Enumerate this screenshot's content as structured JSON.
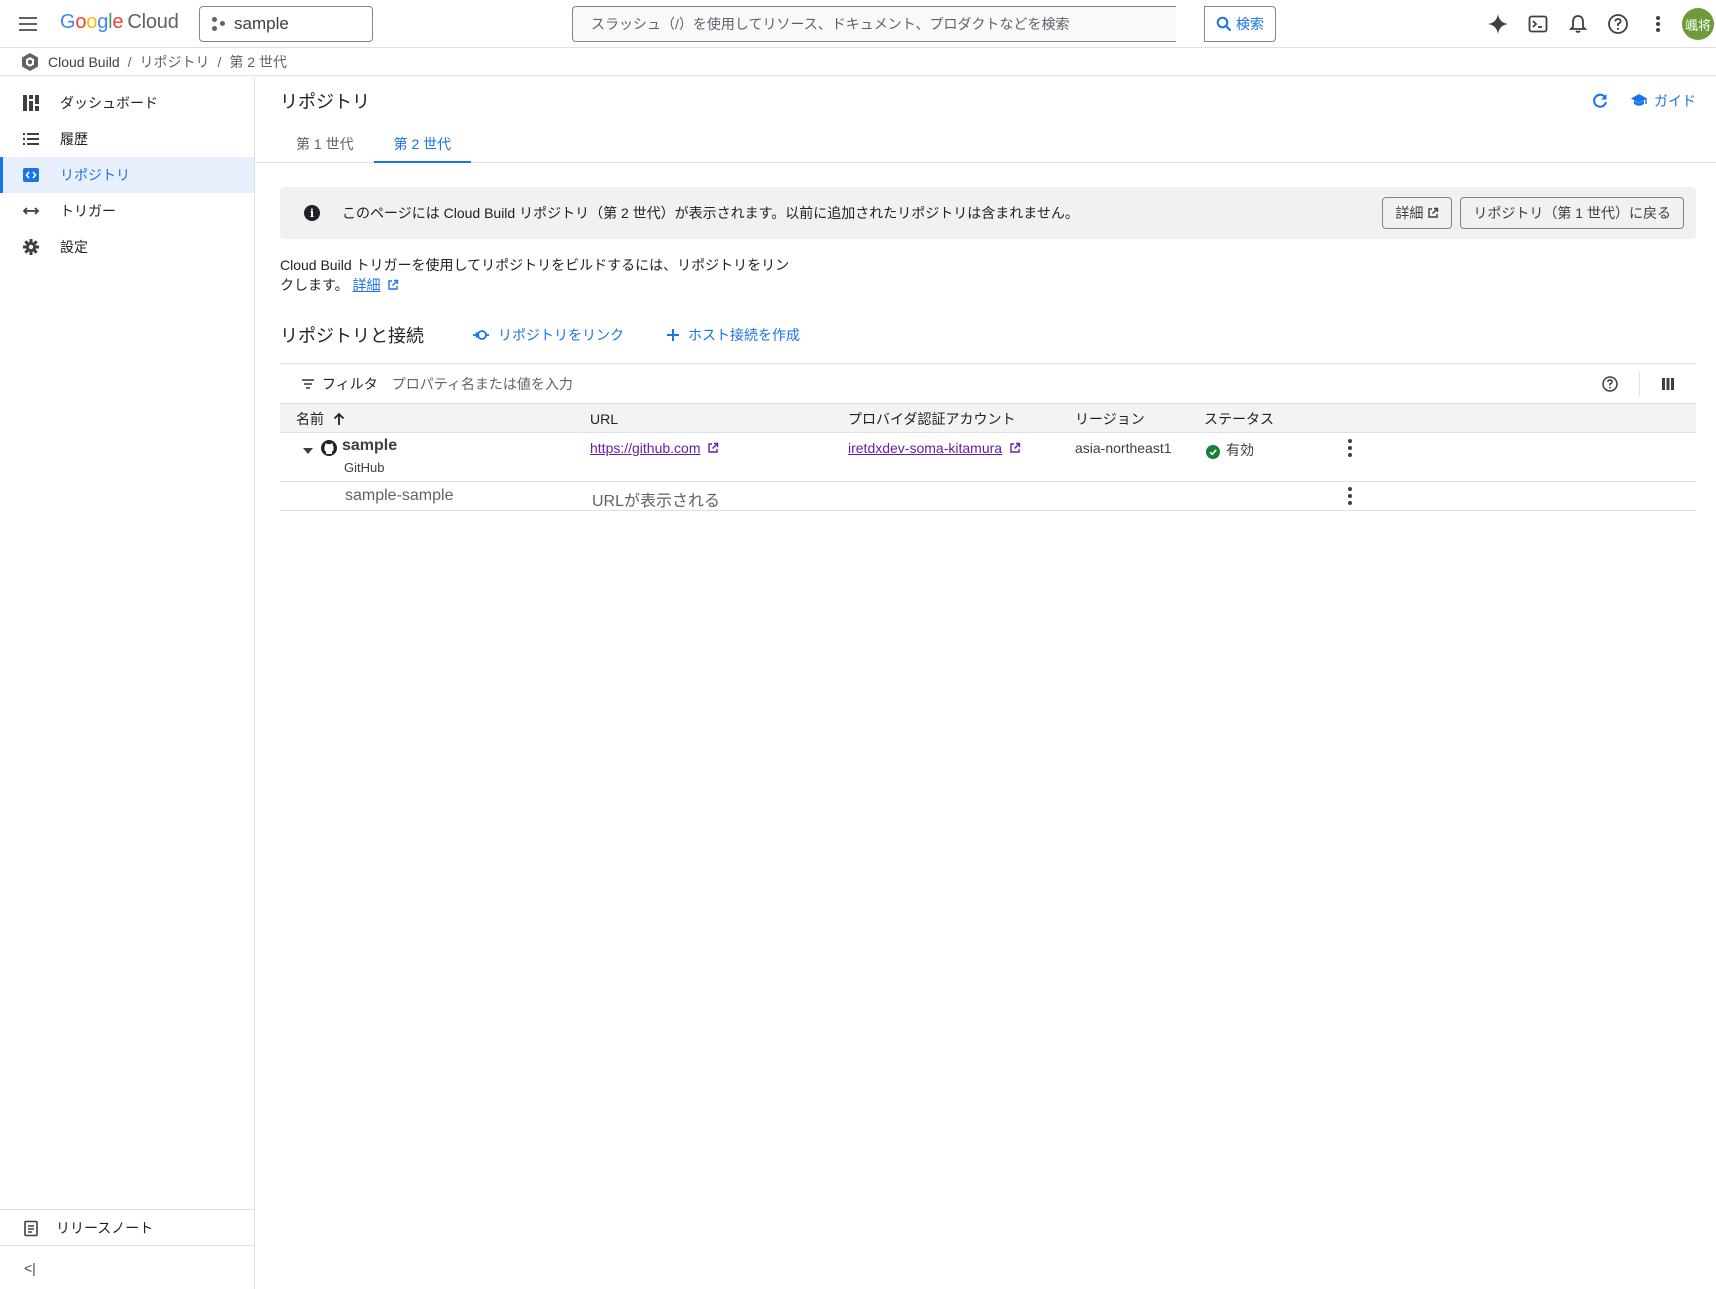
{
  "topbar": {
    "logo_letters": [
      "G",
      "o",
      "o",
      "g",
      "l",
      "e"
    ],
    "logo_cloud": "Cloud",
    "project": "sample",
    "search_placeholder": "スラッシュ（/）を使用してリソース、ドキュメント、プロダクトなどを検索",
    "search_button": "検索",
    "avatar_text": "颯将"
  },
  "breadcrumb": {
    "items": [
      "Cloud Build",
      "リポジトリ",
      "第 2 世代"
    ],
    "separator": "/"
  },
  "sidebar": {
    "items": [
      {
        "label": "ダッシュボード",
        "icon": "dashboard-icon"
      },
      {
        "label": "履歴",
        "icon": "list-icon"
      },
      {
        "label": "リポジトリ",
        "icon": "code-icon"
      },
      {
        "label": "トリガー",
        "icon": "arrows-icon"
      },
      {
        "label": "設定",
        "icon": "gear-icon"
      }
    ],
    "active_index": 2,
    "release_notes": "リリースノート",
    "collapse_icon": "<|"
  },
  "page": {
    "title": "リポジトリ",
    "guide": "ガイド",
    "tabs": [
      "第 1 世代",
      "第 2 世代"
    ],
    "active_tab": 1
  },
  "banner": {
    "text": "このページには Cloud Build リポジトリ（第 2 世代）が表示されます。以前に追加されたリポジトリは含まれません。",
    "details_button": "詳細",
    "back_button": "リポジトリ（第 1 世代）に戻る"
  },
  "description": {
    "line1": "Cloud Build トリガーを使用してリポジトリをビルドするには、リポジトリをリン",
    "line2": "クします。",
    "link": "詳細"
  },
  "section": {
    "title": "リポジトリと接続",
    "link_repo_button": "リポジトリをリンク",
    "create_host_button": "ホスト接続を作成"
  },
  "table": {
    "filter_label": "フィルタ",
    "filter_placeholder": "プロパティ名または値を入力",
    "columns": [
      "名前",
      "URL",
      "プロバイダ認証アカウント",
      "リージョン",
      "ステータス"
    ],
    "connection": {
      "name": "sample",
      "provider": "GitHub",
      "url": "https://github.com",
      "account": "iretdxdev-soma-kitamura",
      "region": "asia-northeast1",
      "status": "有効"
    },
    "repository": {
      "name": "sample-sample",
      "url": "URLが表示される"
    }
  },
  "colors": {
    "accent": "#1a73e8",
    "status_ok": "#188038",
    "link_visited": "#681da8"
  }
}
